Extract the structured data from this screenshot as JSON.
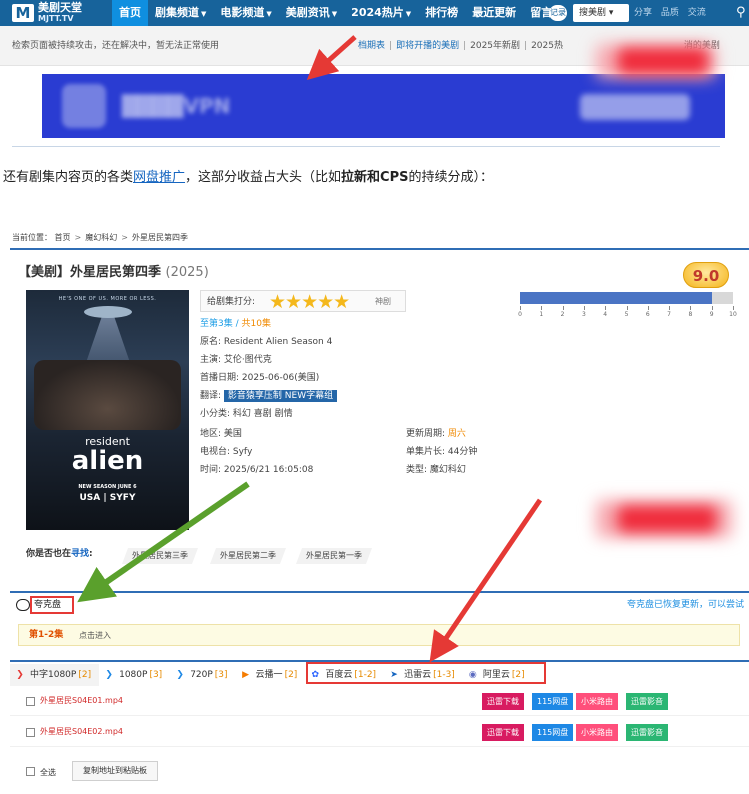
{
  "site": {
    "logo_mark": "M",
    "logo_name": "美剧天堂",
    "logo_sub": "MJTT.TV",
    "nav": [
      {
        "label": "首页",
        "dropdown": false
      },
      {
        "label": "剧集频道",
        "dropdown": true
      },
      {
        "label": "电影频道",
        "dropdown": true
      },
      {
        "label": "美剧资讯",
        "dropdown": true
      },
      {
        "label": "2024热片",
        "dropdown": true
      },
      {
        "label": "排行榜",
        "dropdown": false
      },
      {
        "label": "最近更新",
        "dropdown": false
      },
      {
        "label": "留言",
        "dropdown": false
      }
    ],
    "login": "记录",
    "search_select": "搜美剧",
    "header_links": [
      "分享",
      "品质",
      "交流"
    ],
    "notice": "检索页面被持续攻击，还在解决中，暂无法正常使用",
    "notice_links": [
      {
        "label": "档期表",
        "highlight": true
      },
      {
        "label": "即将开播的美剧",
        "highlight": true
      },
      {
        "label": "2025年新剧",
        "highlight": false
      },
      {
        "label": "2025热",
        "highlight": false
      }
    ],
    "notice_tail": "消的美剧"
  },
  "caption": {
    "part1": "还有剧集内容页的各类",
    "link": "网盘推广",
    "part2": "，这部分收益占大头（比如",
    "bold": "拉新和CPS",
    "part3": "的持续分成）："
  },
  "detail": {
    "breadcrumb": [
      "当前位置：",
      "首页",
      "魔幻科幻",
      "外星居民第四季"
    ],
    "title": "【美剧】外星居民第四季",
    "year": "(2025)",
    "score": "9.0",
    "score_fraction": 0.9,
    "rate_label": "给剧集打分:",
    "stars": "★★★★★",
    "star_count": 5,
    "rate_word": "神剧",
    "tick_labels": [
      "0",
      "1",
      "2",
      "3",
      "4",
      "5",
      "6",
      "7",
      "8",
      "9",
      "10"
    ],
    "poster": {
      "tagline": "HE'S ONE OF US. MORE OR LESS.",
      "resident": "resident",
      "alien": "alien",
      "season": "NEW SEASON JUNE 6",
      "network": "USA | SYFY"
    },
    "episode_prefix": "至第3集",
    "episode_sep": " / ",
    "episode_total": "共10集",
    "original_name": "原名:  Resident Alien Season 4",
    "cast": "主演:  艾伦·图代克",
    "premiere": "首播日期:  2025-06-06(美国)",
    "translation_label": "翻译:",
    "translation_value": "影音猿享压制 NEW字幕组",
    "subgenre": "小分类:  科幻 喜剧 剧情",
    "region": "地区:  美国",
    "network": "电视台:  Syfy",
    "time": "时间:  2025/6/21 16:05:08",
    "update_label": "更新周期:",
    "update_value": "周六",
    "runtime": "单集片长:  44分钟",
    "type": "类型:  魔幻科幻",
    "find_prefix": "你是否也在",
    "find_link": "寻找",
    "find_colon": ":",
    "related": [
      "外星居民第三季",
      "外星居民第二季",
      "外星居民第一季"
    ],
    "cloud_name": "夸克盘",
    "cloud_note": "夸克盘已恢复更新，可以尝试",
    "episode_range": "第1-2集",
    "enter": "点击进入",
    "tabs": [
      {
        "label": "中字1080P",
        "count": "[2]",
        "icon": "quality-icon",
        "color": "#e53935",
        "active": true
      },
      {
        "label": "1080P",
        "count": "[3]",
        "icon": "quality-icon",
        "color": "#1e88e5",
        "active": false
      },
      {
        "label": "720P",
        "count": "[3]",
        "icon": "quality-icon",
        "color": "#1e88e5",
        "active": false
      },
      {
        "label": "云播一",
        "count": "[2]",
        "icon": "play-icon",
        "color": "#f57c00",
        "active": false
      },
      {
        "label": "百度云",
        "count": "[1-2]",
        "icon": "baidu-icon",
        "color": "#2962ff",
        "active": false
      },
      {
        "label": "迅雷云",
        "count": "[1-3]",
        "icon": "thunder-icon",
        "color": "#1565c0",
        "active": false
      },
      {
        "label": "阿里云",
        "count": "[2]",
        "icon": "aliyun-icon",
        "color": "#5c6bc0",
        "active": false
      }
    ],
    "files": [
      {
        "name": "外星居民S04E01.mp4"
      },
      {
        "name": "外星居民S04E02.mp4"
      }
    ],
    "download_buttons": [
      {
        "label": "迅雷下载",
        "color": "#d81b60"
      },
      {
        "label": "115网盘",
        "color": "#1e88e5"
      },
      {
        "label": "小米路由",
        "color": "#ff4f7b"
      },
      {
        "label": "迅雷影音",
        "color": "#2bb673"
      }
    ],
    "select_all": "全选",
    "copy_button": "复制地址到粘贴板"
  },
  "colors": {
    "header": "#17639b",
    "accent_blue": "#2f6db5",
    "annotation_red": "#e53935",
    "annotation_green": "#5aa02c"
  }
}
